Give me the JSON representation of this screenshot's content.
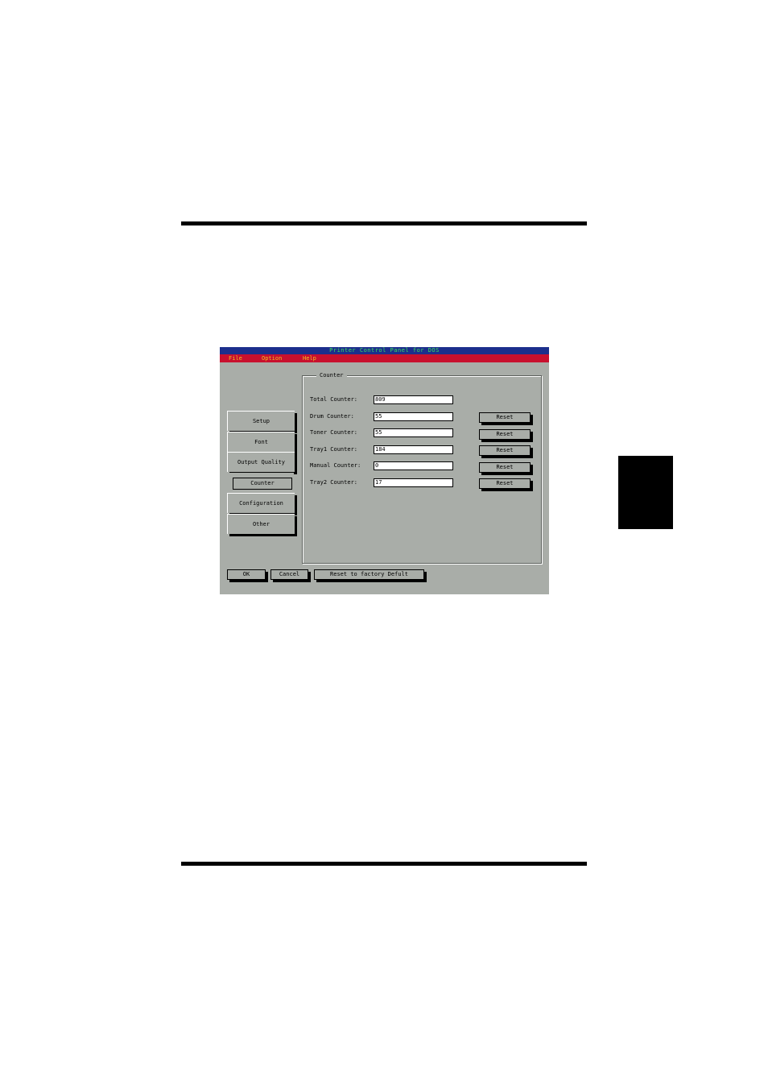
{
  "window": {
    "title": "Printer Control Panel for DOS",
    "colors": {
      "titlebar": "#1c2f8c",
      "title_text": "#3ce05a",
      "menubar": "#c8102e",
      "menu_text": "#f0c020",
      "panel": "#a9ada8"
    }
  },
  "menu": [
    "File",
    "Option",
    "Help"
  ],
  "nav": [
    "Setup",
    "Font",
    "Output Quality",
    "Counter",
    "Configuration",
    "Other"
  ],
  "nav_selected": "Counter",
  "group_title": "Counter",
  "counters": [
    {
      "label": "Total Counter:",
      "value": "809"
    },
    {
      "label": "Drum Counter:",
      "value": "55"
    },
    {
      "label": "Toner Counter:",
      "value": "55"
    },
    {
      "label": "Tray1 Counter:",
      "value": "184"
    },
    {
      "label": "Manual Counter:",
      "value": "0"
    },
    {
      "label": "Tray2 Counter:",
      "value": "17"
    }
  ],
  "reset_label": "Reset",
  "buttons": {
    "ok": "OK",
    "cancel": "Cancel",
    "factory": "Reset to factory Defult"
  }
}
